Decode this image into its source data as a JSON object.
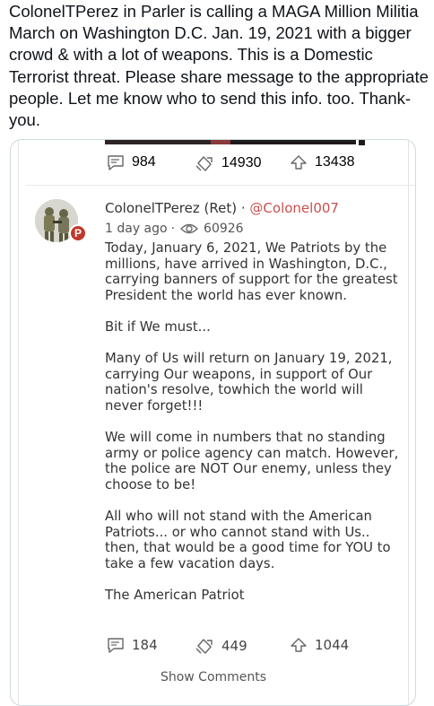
{
  "tweet": {
    "text": "ColonelTPerez in Parler is calling a MAGA Million Militia March on Washington D.C. Jan. 19, 2021 with a bigger crowd & with a lot of weapons. This is a Domestic Terrorist threat. Please share message to the appropriate people. Let me know who to send this info. too. Thank-you."
  },
  "prev_post": {
    "comments": "984",
    "echoes": "14930",
    "upvotes": "13438"
  },
  "post": {
    "name": "ColonelTPerez (Ret)",
    "separator": "·",
    "handle": "@Colonel007",
    "time": "1 day ago",
    "time_sep": "·",
    "views": "60926",
    "badge": "P",
    "paragraphs": [
      "Today, January 6, 2021, We Patriots by the millions, have arrived in Washington, D.C., carrying banners of support for the greatest President the world has ever known.",
      "Bit if We must...",
      "Many of Us will return on January 19, 2021, carrying Our weapons, in support of Our nation's resolve, towhich the world will never forget!!!",
      "We will come in numbers that no standing army or police agency can match. However, the police are NOT Our enemy, unless they choose to be!",
      "All who will not stand with the American Patriots... or who cannot stand with Us.. then, that would be a good time for YOU to take a few vacation days.",
      "The American Patriot"
    ],
    "comments": "184",
    "echoes": "449",
    "upvotes": "1044"
  },
  "show_comments": "Show Comments",
  "colors": {
    "handle": "#c94f4f",
    "badge": "#c0392b",
    "text": "#333333"
  }
}
